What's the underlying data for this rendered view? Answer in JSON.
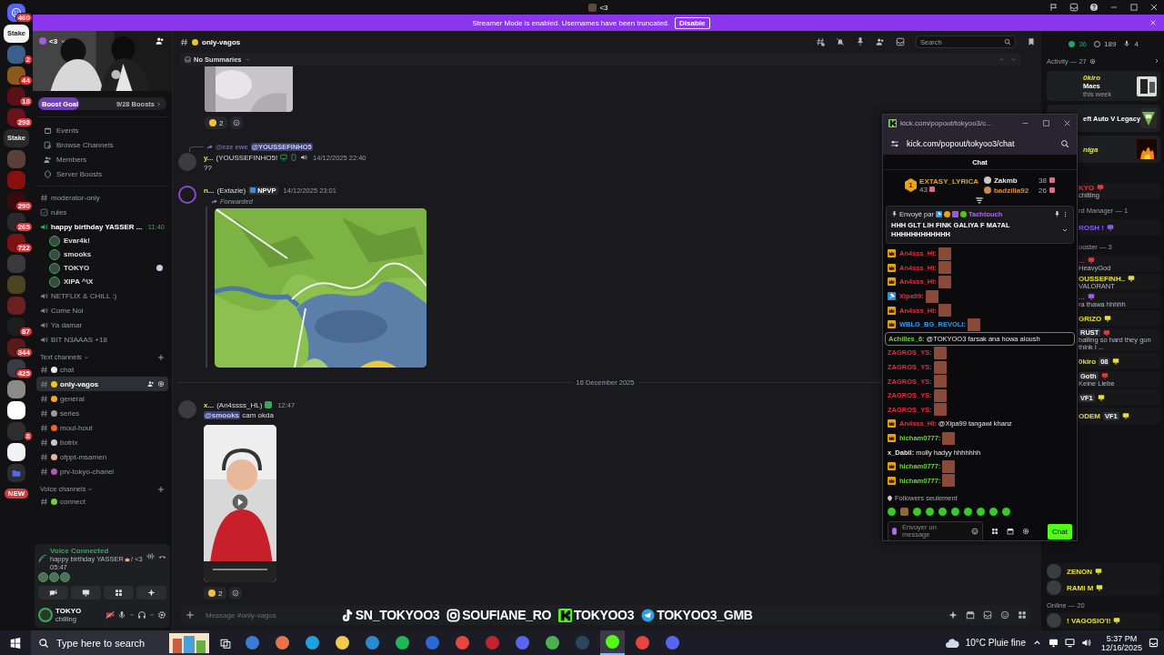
{
  "window": {
    "title": "<3"
  },
  "banner": {
    "text": "Streamer Mode is enabled. Usernames have been truncated.",
    "button": "Disable"
  },
  "servers": [
    {
      "kind": "home",
      "badge": "460",
      "color": "#5865f2"
    },
    {
      "kind": "logo",
      "label": "Stake",
      "color": "#f4f4f4"
    },
    {
      "kind": "server",
      "badge": "2",
      "color": "#3b5f8a"
    },
    {
      "kind": "server",
      "badge": "44",
      "color": "#8a5a1c"
    },
    {
      "kind": "server",
      "badge": "18",
      "color": "#5a1014"
    },
    {
      "kind": "server",
      "badge": "298",
      "color": "#6a1218"
    },
    {
      "kind": "logo",
      "label": "Stake",
      "color": "#2a2a2a"
    },
    {
      "kind": "server",
      "color": "#5a4038"
    },
    {
      "kind": "server",
      "color": "#8a1010"
    },
    {
      "kind": "server",
      "badge": "290",
      "color": "#3a0a0c"
    },
    {
      "kind": "server",
      "badge": "265",
      "color": "#2a2a2a"
    },
    {
      "kind": "server",
      "badge": "722",
      "color": "#7a1414"
    },
    {
      "kind": "server",
      "color": "#3a3a3a"
    },
    {
      "kind": "server",
      "color": "#4a4420"
    },
    {
      "kind": "server",
      "color": "#6a2020"
    },
    {
      "kind": "server",
      "badge": "87",
      "color": "#1e1e1e"
    },
    {
      "kind": "server",
      "badge": "344",
      "color": "#5a1a1a"
    },
    {
      "kind": "server",
      "badge": "425",
      "color": "#3a3a44"
    },
    {
      "kind": "server",
      "color": "#8a8a86"
    },
    {
      "kind": "server",
      "color": "#ffffff"
    },
    {
      "kind": "server",
      "badge": "8",
      "color": "#2e2e2e"
    },
    {
      "kind": "server",
      "color": "#f2f2f2"
    },
    {
      "kind": "folder",
      "color": "#5865f2"
    },
    {
      "kind": "new",
      "label": "NEW",
      "color": "#da373c"
    }
  ],
  "server": {
    "name": "<3",
    "boost_label": "Boost Goal",
    "boosts": "9/28 Boosts",
    "level": 0.32
  },
  "menu": [
    "Events",
    "Browse Channels",
    "Members",
    "Server Boosts"
  ],
  "channels": [
    {
      "kind": "text",
      "name": "moderator-only",
      "selected": false
    },
    {
      "kind": "rules",
      "name": "rules",
      "selected": false
    },
    {
      "kind": "voice",
      "name": "happy birthday YASSER ...",
      "time": "11:40",
      "connected": true,
      "selected": false,
      "users": [
        {
          "name": "Evar4k!"
        },
        {
          "name": "smooks"
        },
        {
          "name": "TOKYO"
        },
        {
          "name": "XIPA ^\\X"
        }
      ]
    },
    {
      "kind": "voice",
      "name": "NETFLIX & CHILL :)",
      "connected": false,
      "selected": false
    },
    {
      "kind": "voice",
      "name": "Come Noi",
      "connected": false,
      "selected": false
    },
    {
      "kind": "voice",
      "name": "Ya damar",
      "connected": false,
      "selected": false
    },
    {
      "kind": "voice",
      "name": "BIT N3AAAS +18",
      "connected": false,
      "selected": false
    },
    {
      "kind": "category",
      "name": "Text channels"
    },
    {
      "kind": "text",
      "name": "chat",
      "color": "#e8e8e8",
      "selected": false
    },
    {
      "kind": "text",
      "name": "only-vagos",
      "color": "#f0c419",
      "selected": true
    },
    {
      "kind": "text",
      "name": "general",
      "color": "#f5a623",
      "selected": false
    },
    {
      "kind": "text",
      "name": "series",
      "color": "#9a9a9a",
      "selected": false
    },
    {
      "kind": "text",
      "name": "moul-hout",
      "color": "#f26522",
      "selected": false
    },
    {
      "kind": "text",
      "name": "botrix",
      "color": "#c8c8c8",
      "selected": false
    },
    {
      "kind": "text",
      "name": "ofppt-msamen",
      "color": "#e8b4a0",
      "selected": false
    },
    {
      "kind": "text",
      "name": "prv-tokyo-chanel",
      "color": "#b05ab0",
      "selected": false
    },
    {
      "kind": "category",
      "name": "Voice channels"
    },
    {
      "kind": "text",
      "name": "connect",
      "color": "#7ac943",
      "selected": false
    }
  ],
  "voice_panel": {
    "status": "Voice Connected",
    "channel": "happy birthday YASSER",
    "server": "/ <3",
    "timer": "05:47"
  },
  "user": {
    "name": "TOKYO",
    "status": "chilling"
  },
  "chat": {
    "channel": "only-vagos",
    "summaries": "No Summaries",
    "search_placeholder": "Search",
    "messages": [
      {
        "kind": "tail",
        "reactions": [
          "2"
        ]
      },
      {
        "kind": "message",
        "reply_user": "@eze ewe",
        "reply_to": "@YOUSSEFINHO5",
        "author": "y...",
        "nick": "(YOUSSEFINHO5!",
        "time": "14/12/2025 22:40",
        "text": "??"
      },
      {
        "kind": "message",
        "author": "n...",
        "nick": "(Extazie)",
        "tag": "NPVP",
        "time": "14/12/2025 23:01",
        "forwarded": "Forwarded",
        "media": {
          "kind": "map"
        }
      },
      {
        "kind": "divider",
        "text": "16 December 2025"
      },
      {
        "kind": "message",
        "author": "x...",
        "nick": "(An4ssss_HL)",
        "time": "12:47",
        "mention": "@smooks",
        "text": "cam okda",
        "media": {
          "kind": "video"
        },
        "reactions": [
          "2"
        ]
      }
    ],
    "composer_placeholder": "Message #only-vagos",
    "socials": [
      {
        "kind": "tiktok",
        "handle": "SN_TOKYOO3"
      },
      {
        "kind": "instagram",
        "handle": "SOUFIANE_RO"
      },
      {
        "kind": "kick",
        "handle": "TOKYOO3"
      },
      {
        "kind": "telegram",
        "handle": "TOKYOO3_GMB"
      }
    ]
  },
  "members": {
    "online": "36",
    "offline": "189",
    "voice": "4",
    "activity_header": "Activity — 27",
    "activity": [
      {
        "name": "0kiro",
        "line": "Maes",
        "sub": "this week"
      },
      {
        "line": "eft Auto V Legacy"
      },
      {
        "name": "niga"
      }
    ],
    "rows_beside_popout": [
      {
        "kind": "member",
        "name": "KYO",
        "sub": "chilling",
        "color": "#e03a3a"
      },
      {
        "kind": "header",
        "name": "rd Manager — 1"
      },
      {
        "kind": "member",
        "name": "ROSH !",
        "color": "#8a5cf0"
      },
      {
        "kind": "header",
        "name": "ooster — 3"
      },
      {
        "kind": "member",
        "name": "...",
        "sub": "HeavyGod",
        "color": "#e03a3a"
      },
      {
        "kind": "member",
        "name": "OUSSEFINH..",
        "sub": "VALORANT",
        "color": "#e6e03a"
      },
      {
        "kind": "member",
        "name": "...",
        "sub": "ra thawa hhhhh",
        "color": "#b05cf0"
      },
      {
        "kind": "member",
        "name": "GRIZO",
        "color": "#e6e03a"
      },
      {
        "kind": "member",
        "tag": "RUST",
        "sub": "balling so hard they gon think i ...",
        "color": "#e03a3a"
      },
      {
        "kind": "member",
        "name": "0kiro",
        "tag": "08",
        "color": "#e6e03a"
      },
      {
        "kind": "member",
        "tag": "Goth",
        "sub": "Keine Liebe",
        "color": "#e03a3a"
      },
      {
        "kind": "member",
        "tag": "VF1",
        "color": "#e6e03a"
      },
      {
        "kind": "member",
        "name": "ODEM",
        "tag": "VF1",
        "color": "#e6e03a"
      }
    ],
    "rows": [
      {
        "kind": "member",
        "name": "ZENON",
        "color": "#e6e03a"
      },
      {
        "kind": "member",
        "name": "RAMI M",
        "color": "#e6e03a"
      },
      {
        "kind": "header",
        "name": "Online — 20"
      },
      {
        "kind": "member",
        "name": "! VAGOSIO'I!",
        "color": "#e6e03a"
      }
    ]
  },
  "popout": {
    "tab_title": "kick.com/popout/tokyoo3/c...",
    "url": "kick.com/popout/tokyoo3/chat",
    "heading": "Chat",
    "leaders": [
      {
        "rank": "1",
        "name": "EXTASY_LYRICA",
        "count": "43"
      },
      {
        "name": "Zakmb",
        "count": "38"
      },
      {
        "name": "badzilla92",
        "count": "26"
      }
    ],
    "pinned": {
      "label": "Envoyé par",
      "user": "Tachtouch",
      "text": "HHH GLT LIH FINK GALIYA F MA7AL HHHHHHHHHHHH"
    },
    "messages": [
      {
        "kind": "crown",
        "user": "An4sss_HI:",
        "color": "#e0303a",
        "emote": true,
        "highlighted": false
      },
      {
        "kind": "crown",
        "user": "An4sss_HI:",
        "color": "#e0303a",
        "emote": true,
        "highlighted": false
      },
      {
        "kind": "crown",
        "user": "An4sss_HI:",
        "color": "#e0303a",
        "emote": true,
        "highlighted": false
      },
      {
        "kind": "hammer",
        "user": "Xipa99:",
        "color": "#e0303a",
        "emote": true,
        "highlighted": false
      },
      {
        "kind": "crown",
        "user": "An4sss_HI:",
        "color": "#e0303a",
        "emote": true,
        "highlighted": false
      },
      {
        "kind": "crown",
        "user": "WBLG_BG_REVOLI:",
        "color": "#3a9ae8",
        "emote": true,
        "highlighted": false
      },
      {
        "kind": "plain",
        "user": "Achilles_6:",
        "color": "#7ad04a",
        "text": "@TOKYOO3 farsak ana howa aloush",
        "emote": false,
        "highlighted": true
      },
      {
        "kind": "plain",
        "user": "ZAGROS_YS:",
        "color": "#e0303a",
        "emote": true,
        "highlighted": false
      },
      {
        "kind": "plain",
        "user": "ZAGROS_YS:",
        "color": "#e0303a",
        "emote": true,
        "highlighted": false
      },
      {
        "kind": "plain",
        "user": "ZAGROS_YS:",
        "color": "#e0303a",
        "emote": true,
        "highlighted": false
      },
      {
        "kind": "plain",
        "user": "ZAGROS_YS:",
        "color": "#e0303a",
        "emote": true,
        "highlighted": false
      },
      {
        "kind": "plain",
        "user": "ZAGROS_YS:",
        "color": "#e0303a",
        "emote": true,
        "highlighted": false
      },
      {
        "kind": "crown",
        "user": "An4sss_HI:",
        "color": "#e0303a",
        "text": "@Xipa99 tangawi khanz",
        "emote": false,
        "highlighted": false
      },
      {
        "kind": "crown",
        "user": "hicham0777:",
        "color": "#6bd53d",
        "emote": true,
        "highlighted": false
      },
      {
        "kind": "plain",
        "user": "x_Dabil:",
        "color": "#e8e8e8",
        "text": "molly hadyy hhhhhhh",
        "emote": false,
        "highlighted": false
      },
      {
        "kind": "crown",
        "user": "hicham0777:",
        "color": "#6bd53d",
        "emote": true,
        "highlighted": false
      },
      {
        "kind": "crown",
        "user": "hicham0777:",
        "color": "#6bd53d",
        "emote": true,
        "highlighted": false
      }
    ],
    "mode": "Followers seulement",
    "input_placeholder": "Envoyer un message",
    "send": "Chat"
  },
  "taskbar": {
    "search_placeholder": "Type here to search",
    "weather": "10°C Pluie fine",
    "time": "5:37 PM",
    "date": "12/16/2025",
    "apps": [
      {
        "color": "#3a7bd5",
        "selected": false
      },
      {
        "color": "#e8734a",
        "selected": false
      },
      {
        "color": "#1fa0e0",
        "selected": false
      },
      {
        "color": "#f2c94c",
        "selected": false
      },
      {
        "color": "#2a8ad4",
        "selected": false
      },
      {
        "color": "#1db954",
        "selected": false
      },
      {
        "color": "#2a6ad4",
        "selected": false
      },
      {
        "color": "#e8453c",
        "selected": false
      },
      {
        "color": "#c0242c",
        "selected": false
      },
      {
        "color": "#5865f2",
        "selected": false
      },
      {
        "color": "#4caf50",
        "selected": false
      },
      {
        "color": "#2a475e",
        "selected": false
      },
      {
        "color": "#53fc18",
        "selected": true
      },
      {
        "color": "#e8453c",
        "selected": false
      },
      {
        "color": "#5865f2",
        "selected": false
      }
    ]
  }
}
